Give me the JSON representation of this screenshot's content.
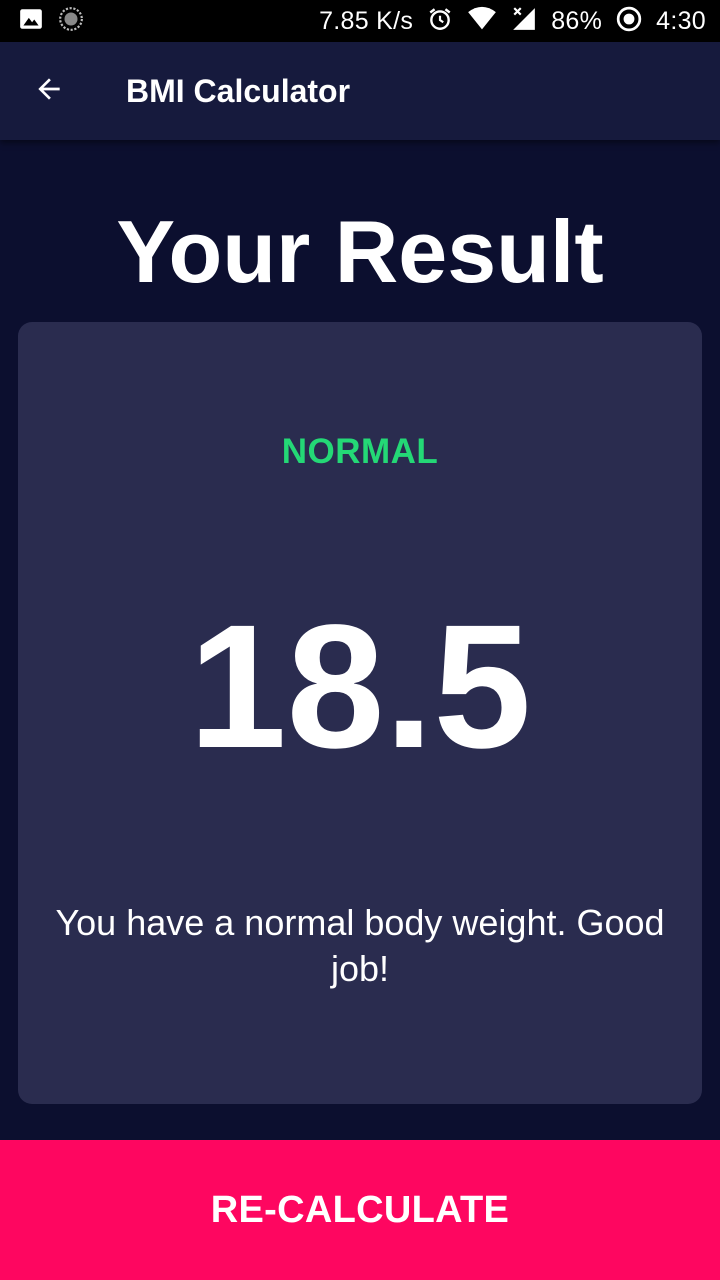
{
  "status_bar": {
    "left_icons": [
      "image-icon",
      "sync-circle-icon"
    ],
    "net_speed": "7.85 K/s",
    "battery": "86%",
    "time": "4:30",
    "right_icons": [
      "alarm-icon",
      "wifi-icon",
      "signal-icon",
      "battery-icon"
    ]
  },
  "app_bar": {
    "title": "BMI Calculator",
    "back_icon": "arrow-back-icon"
  },
  "page": {
    "heading": "Your Result"
  },
  "result": {
    "status": "NORMAL",
    "bmi": "18.5",
    "interpretation": "You have a normal body weight. Good job!"
  },
  "actions": {
    "recalculate_label": "RE-CALCULATE"
  },
  "colors": {
    "background": "#0c0f2f",
    "app_bar": "#161a3d",
    "card": "#2a2c4f",
    "status_normal": "#24d876",
    "accent": "#fe0660"
  }
}
